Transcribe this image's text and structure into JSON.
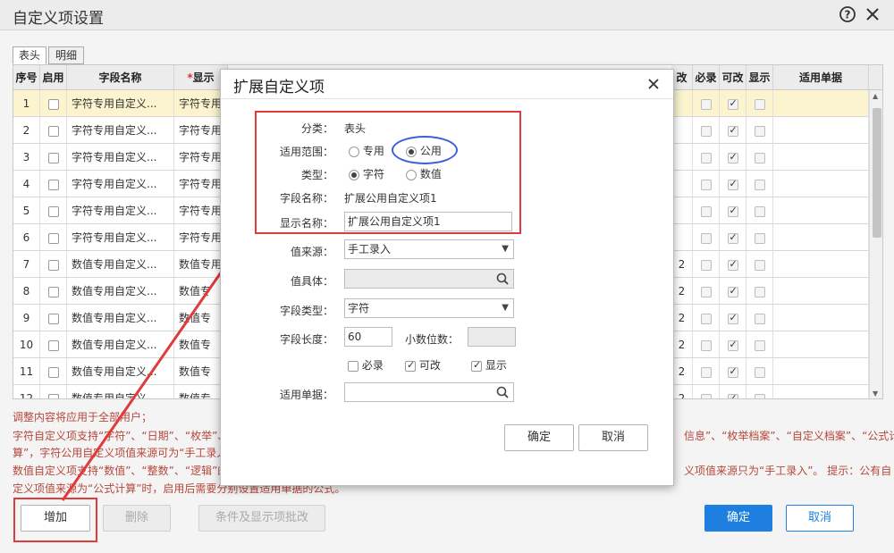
{
  "window": {
    "title": "自定义项设置",
    "help_icon": "question-circle-icon",
    "close_icon": "close-icon"
  },
  "tabs": [
    {
      "label": "表头",
      "active": true
    },
    {
      "label": "明细",
      "active": false
    }
  ],
  "grid": {
    "headers": {
      "seq": "序号",
      "enabled": "启用",
      "field_name": "字段名称",
      "display_required_mark": "*",
      "display": "显示",
      "hidden_partial": "改",
      "required": "必录",
      "editable": "可改",
      "show": "显示",
      "applicable": "适用单据"
    },
    "rows": [
      {
        "seq": "1",
        "field": "字符专用自定义...",
        "display": "字符专用",
        "sub": "",
        "selected": true
      },
      {
        "seq": "2",
        "field": "字符专用自定义...",
        "display": "字符专用",
        "sub": ""
      },
      {
        "seq": "3",
        "field": "字符专用自定义...",
        "display": "字符专用",
        "sub": ""
      },
      {
        "seq": "4",
        "field": "字符专用自定义...",
        "display": "字符专用",
        "sub": ""
      },
      {
        "seq": "5",
        "field": "字符专用自定义...",
        "display": "字符专用",
        "sub": ""
      },
      {
        "seq": "6",
        "field": "字符专用自定义...",
        "display": "字符专用",
        "sub": ""
      },
      {
        "seq": "7",
        "field": "数值专用自定义...",
        "display": "数值专用",
        "sub": "2"
      },
      {
        "seq": "8",
        "field": "数值专用自定义...",
        "display": "数值专",
        "sub": "2"
      },
      {
        "seq": "9",
        "field": "数值专用自定义...",
        "display": "数值专",
        "sub": "2"
      },
      {
        "seq": "10",
        "field": "数值专用自定义...",
        "display": "数值专",
        "sub": "2"
      },
      {
        "seq": "11",
        "field": "数值专用自定义...",
        "display": "数值专",
        "sub": "2"
      },
      {
        "seq": "12",
        "field": "数值专用自定义...",
        "display": "数值专",
        "sub": "2"
      }
    ]
  },
  "notice": {
    "line1": "调整内容将应用于全部用户；",
    "line2_left": "字符自定义项支持“字符”、“日期”、“枚举”、“",
    "line2_right": "信息”、“枚举档案”、“自定义档案”、“公式计",
    "line3_left": "算”，字符公用自定义项值来源可为“手工录入",
    "line4_left": "数值自定义项支持“数值”、“整数”、“逻辑”的",
    "line4_right": "义项值来源只为“手工录入”。 提示：公有自",
    "line5": "定义项值来源为“公式计算”时，启用后需要分别设置适用单据的公式。"
  },
  "bottom_buttons": {
    "add": "增加",
    "delete": "删除",
    "batch": "条件及显示项批改",
    "ok": "确定",
    "cancel": "取消"
  },
  "dialog": {
    "title": "扩展自定义项",
    "close_icon": "close-icon",
    "category_label": "分类：",
    "category_value": "表头",
    "scope_label": "适用范围：",
    "scope_private": "专用",
    "scope_public": "公用",
    "type_label": "类型：",
    "type_char": "字符",
    "type_number": "数值",
    "field_name_label": "字段名称：",
    "field_name_value": "扩展公用自定义项1",
    "display_name_label": "显示名称：",
    "display_name_value": "扩展公用自定义项1",
    "source_label": "值来源：",
    "source_value": "手工录入",
    "entity_label": "值具体：",
    "field_type_label": "字段类型：",
    "field_type_value": "字符",
    "length_label": "字段长度：",
    "length_value": "60",
    "decimal_label": "小数位数：",
    "required_label": "必录",
    "editable_label": "可改",
    "show_label": "显示",
    "applicable_label": "适用单据：",
    "ok": "确定",
    "cancel": "取消"
  },
  "colors": {
    "annotation_red": "#e03a3a",
    "annotation_blue": "#3d5fd6",
    "primary_blue": "#1e7fe0",
    "selected_row": "#fbf4cf",
    "notice_text": "#b5483b"
  }
}
